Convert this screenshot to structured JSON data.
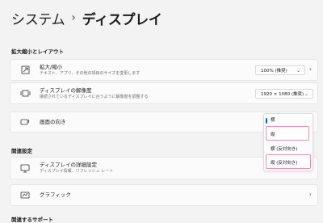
{
  "header": {
    "crumb_parent": "システム",
    "separator": "›",
    "crumb_current": "ディスプレイ"
  },
  "sections": {
    "scale_layout": "拡大縮小とレイアウト",
    "related_settings": "関連設定",
    "related_support": "関連するサポート"
  },
  "scale": {
    "title": "拡大/縮小",
    "desc": "テキスト、アプリ、その他の項目のサイズを変更します",
    "value": "100% (推奨)"
  },
  "resolution": {
    "title": "ディスプレイの解像度",
    "desc": "接続されているディスプレイに合うように解像度を調整する",
    "value": "1920 × 1080 (推奨)"
  },
  "orientation": {
    "title": "画面の向き",
    "options": [
      "横",
      "縦",
      "横 (反対向き)",
      "縦 (反対向き)"
    ],
    "selected": "横"
  },
  "advanced": {
    "title": "ディスプレイの詳細設定",
    "desc": "ディスプレイ情報、リフレッシュ レート"
  },
  "graphics": {
    "title": "グラフィック"
  },
  "colors": {
    "accent": "#0067c0",
    "highlight": "#e78fb2"
  }
}
